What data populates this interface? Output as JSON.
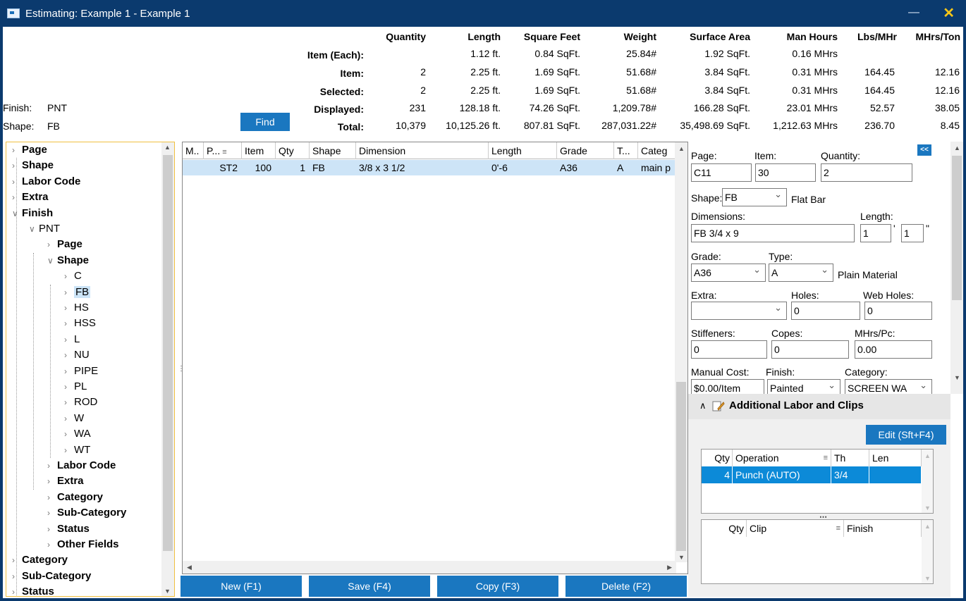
{
  "window": {
    "title": "Estimating: Example 1 - Example 1",
    "minimize": "—",
    "close": "✕"
  },
  "summary": {
    "headers": [
      "Quantity",
      "Length",
      "Square Feet",
      "Weight",
      "Surface Area",
      "Man Hours",
      "Lbs/MHr",
      "MHrs/Ton"
    ],
    "rows": [
      {
        "label": "Item (Each):",
        "values": [
          "",
          "1.12 ft.",
          "0.84 SqFt.",
          "25.84#",
          "1.92 SqFt.",
          "0.16 MHrs",
          "",
          ""
        ]
      },
      {
        "label": "Item:",
        "values": [
          "2",
          "2.25 ft.",
          "1.69 SqFt.",
          "51.68#",
          "3.84 SqFt.",
          "0.31 MHrs",
          "164.45",
          "12.16"
        ]
      },
      {
        "label": "Selected:",
        "values": [
          "2",
          "2.25 ft.",
          "1.69 SqFt.",
          "51.68#",
          "3.84 SqFt.",
          "0.31 MHrs",
          "164.45",
          "12.16"
        ]
      },
      {
        "label": "Displayed:",
        "values": [
          "231",
          "128.18 ft.",
          "74.26 SqFt.",
          "1,209.78#",
          "166.28 SqFt.",
          "23.01 MHrs",
          "52.57",
          "38.05"
        ]
      },
      {
        "label": "Total:",
        "values": [
          "10,379",
          "10,125.26 ft.",
          "807.81 SqFt.",
          "287,031.22#",
          "35,498.69 SqFt.",
          "1,212.63 MHrs",
          "236.70",
          "8.45"
        ]
      }
    ],
    "filters": {
      "finish_label": "Finish:",
      "finish_value": "PNT",
      "shape_label": "Shape:",
      "shape_value": "FB"
    },
    "find_label": "Find"
  },
  "tree": {
    "top": [
      "Page",
      "Shape",
      "Labor Code",
      "Extra",
      "Finish"
    ],
    "pnt": "PNT",
    "pnt_children": [
      "Page",
      "Shape"
    ],
    "shapes": [
      "C",
      "FB",
      "HS",
      "HSS",
      "L",
      "NU",
      "PIPE",
      "PL",
      "ROD",
      "W",
      "WA",
      "WT"
    ],
    "pnt_after": [
      "Labor Code",
      "Extra",
      "Category",
      "Sub-Category",
      "Status",
      "Other Fields"
    ],
    "bottom": [
      "Category",
      "Sub-Category",
      "Status"
    ]
  },
  "grid": {
    "columns": [
      "M..",
      "P...",
      "Item",
      "Qty",
      "Shape",
      "Dimension",
      "Length",
      "Grade",
      "T...",
      "Categ"
    ],
    "row": [
      "",
      "ST2",
      "100",
      "1",
      "FB",
      "3/8 x 3 1/2",
      "0'-6",
      "A36",
      "A",
      "main p"
    ]
  },
  "actions": {
    "new": "New (F1)",
    "save": "Save (F4)",
    "copy": "Copy (F3)",
    "delete": "Delete (F2)"
  },
  "detail": {
    "page_label": "Page:",
    "page_value": "C11",
    "item_label": "Item:",
    "item_value": "30",
    "quantity_label": "Quantity:",
    "quantity_value": "2",
    "collapse": "<<",
    "shape_label": "Shape:",
    "shape_value": "FB",
    "shape_desc": "Flat Bar",
    "dimensions_label": "Dimensions:",
    "dimensions_value": "FB 3/4 x 9",
    "length_label": "Length:",
    "length_ft": "1",
    "length_in": "1",
    "ft_mark": "'",
    "in_mark": "\"",
    "grade_label": "Grade:",
    "grade_value": "A36",
    "type_label": "Type:",
    "type_value": "A",
    "type_desc": "Plain Material",
    "extra_label": "Extra:",
    "extra_value": "",
    "holes_label": "Holes:",
    "holes_value": "0",
    "web_holes_label": "Web Holes:",
    "web_holes_value": "0",
    "stiffeners_label": "Stiffeners:",
    "stiffeners_value": "0",
    "copes_label": "Copes:",
    "copes_value": "0",
    "mhrs_label": "MHrs/Pc:",
    "mhrs_value": "0.00",
    "manual_cost_label": "Manual Cost:",
    "manual_cost_value": "$0.00/Item",
    "finish_label": "Finish:",
    "finish_value": "Painted",
    "category_label": "Category:",
    "category_value": "SCREEN WA"
  },
  "labor": {
    "title": "Additional Labor and Clips",
    "edit": "Edit (Sft+F4)",
    "op_columns": [
      "Qty",
      "Operation",
      "Th",
      "Len"
    ],
    "op_row": [
      "4",
      "Punch (AUTO)",
      "3/4",
      ""
    ],
    "clip_columns": [
      "Qty",
      "Clip",
      "Finish"
    ]
  }
}
